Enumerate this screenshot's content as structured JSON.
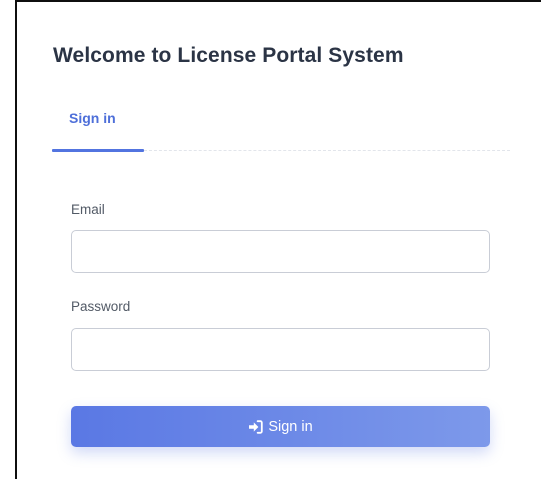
{
  "header": {
    "title": "Welcome to License Portal System"
  },
  "tabs": [
    {
      "label": "Sign in",
      "active": true
    }
  ],
  "form": {
    "email": {
      "label": "Email",
      "value": "",
      "placeholder": ""
    },
    "password": {
      "label": "Password",
      "value": "",
      "placeholder": ""
    },
    "submit": {
      "label": "Sign in",
      "icon": "sign-in-icon"
    }
  },
  "colors": {
    "accent": "#5274e0",
    "title": "#2b3445",
    "button_start": "#5a78e4",
    "button_end": "#7d99ea"
  }
}
